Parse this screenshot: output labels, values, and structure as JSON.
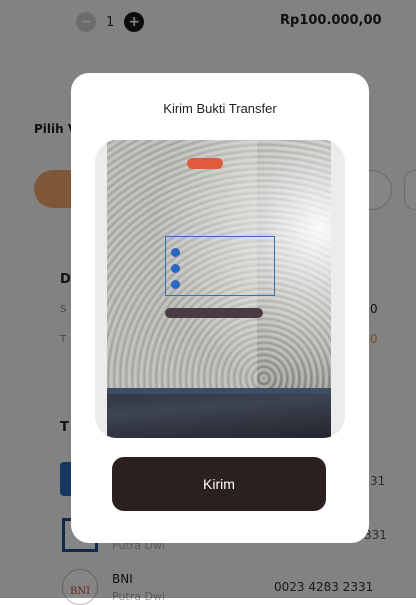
{
  "background": {
    "quantity": "1",
    "price": "Rp100.000,00",
    "pilih_label": "Pilih V",
    "section_d_label": "D",
    "section_s_label": "S",
    "section_t_label": "T",
    "value_0_a": "0",
    "value_0_b": "0",
    "transfer_label": "T",
    "banks": [
      {
        "number": "31",
        "holder": ""
      },
      {
        "number": "331",
        "holder": "Putra Dwi"
      },
      {
        "name": "BNI",
        "logo_text": "BNI",
        "holder": "Putra Dwi",
        "number": "0023 4283 2331"
      }
    ]
  },
  "modal": {
    "title": "Kirim Bukti Transfer",
    "submit_label": "Kirim"
  },
  "colors": {
    "overlay": "#000000",
    "submit_bg": "#2a201d",
    "accent_orange": "#f0a86a"
  },
  "icons": {
    "minus": "minus-icon",
    "plus": "plus-icon"
  }
}
